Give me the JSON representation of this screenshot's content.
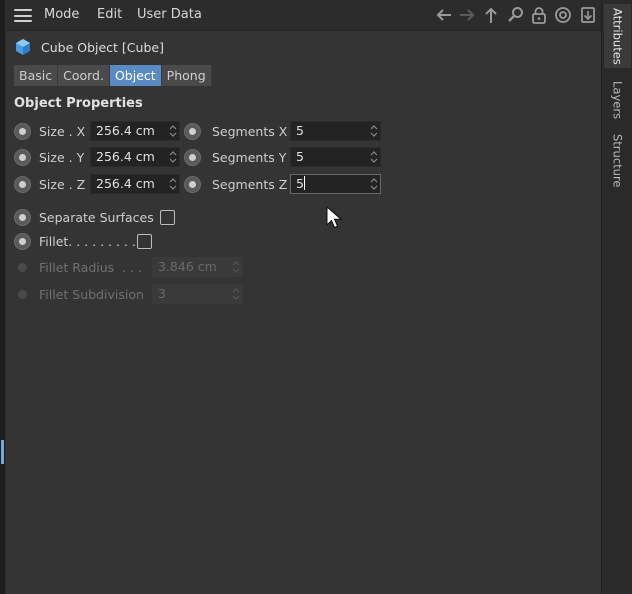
{
  "menu": {
    "items": [
      "Mode",
      "Edit",
      "User Data"
    ]
  },
  "toolbar": {
    "icons": [
      "arrow-left-icon",
      "arrow-right-icon",
      "arrow-up-icon",
      "search-icon",
      "lock-icon",
      "target-icon",
      "new-panel-icon"
    ]
  },
  "object": {
    "title": "Cube Object [Cube]",
    "icon": "cube-icon"
  },
  "tabs": [
    {
      "label": "Basic",
      "active": false
    },
    {
      "label": "Coord.",
      "active": false
    },
    {
      "label": "Object",
      "active": true
    },
    {
      "label": "Phong",
      "active": false
    }
  ],
  "section": {
    "title": "Object Properties"
  },
  "size": {
    "x_label": "Size . X",
    "y_label": "Size . Y",
    "z_label": "Size . Z",
    "x_value": "256.4 cm",
    "y_value": "256.4 cm",
    "z_value": "256.4 cm"
  },
  "segments": {
    "x_label": "Segments X",
    "y_label": "Segments Y",
    "z_label": "Segments Z",
    "x_value": "5",
    "y_value": "5",
    "z_value": "5"
  },
  "options": {
    "separate_surfaces_label": "Separate Surfaces",
    "separate_surfaces_checked": false,
    "fillet_label": "Fillet. . . . . . . . .",
    "fillet_checked": false,
    "fillet_radius_label": "Fillet Radius  . . .",
    "fillet_radius_value": "3.846 cm",
    "fillet_subdivision_label": "Fillet Subdivision",
    "fillet_subdivision_value": "3"
  },
  "side_tabs": [
    {
      "label": "Attributes",
      "active": true
    },
    {
      "label": "Layers",
      "active": false
    },
    {
      "label": "Structure",
      "active": false
    }
  ],
  "colors": {
    "panel": "#343434",
    "menubar": "#2c2c2c",
    "accent": "#5a8ac4",
    "field": "#232323"
  }
}
